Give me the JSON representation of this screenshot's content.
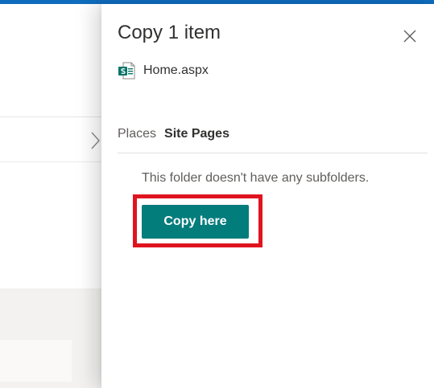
{
  "panel": {
    "title": "Copy 1 item",
    "file": {
      "name": "Home.aspx",
      "icon": "sharepoint-page-icon",
      "icon_color": "#077568"
    },
    "breadcrumb": {
      "places": "Places",
      "current": "Site Pages"
    },
    "empty_message": "This folder doesn't have any subfolders.",
    "copy_button": {
      "label": "Copy here",
      "color": "#037c7c"
    },
    "close_icon": "close-icon",
    "highlight_color": "#e0141f"
  }
}
